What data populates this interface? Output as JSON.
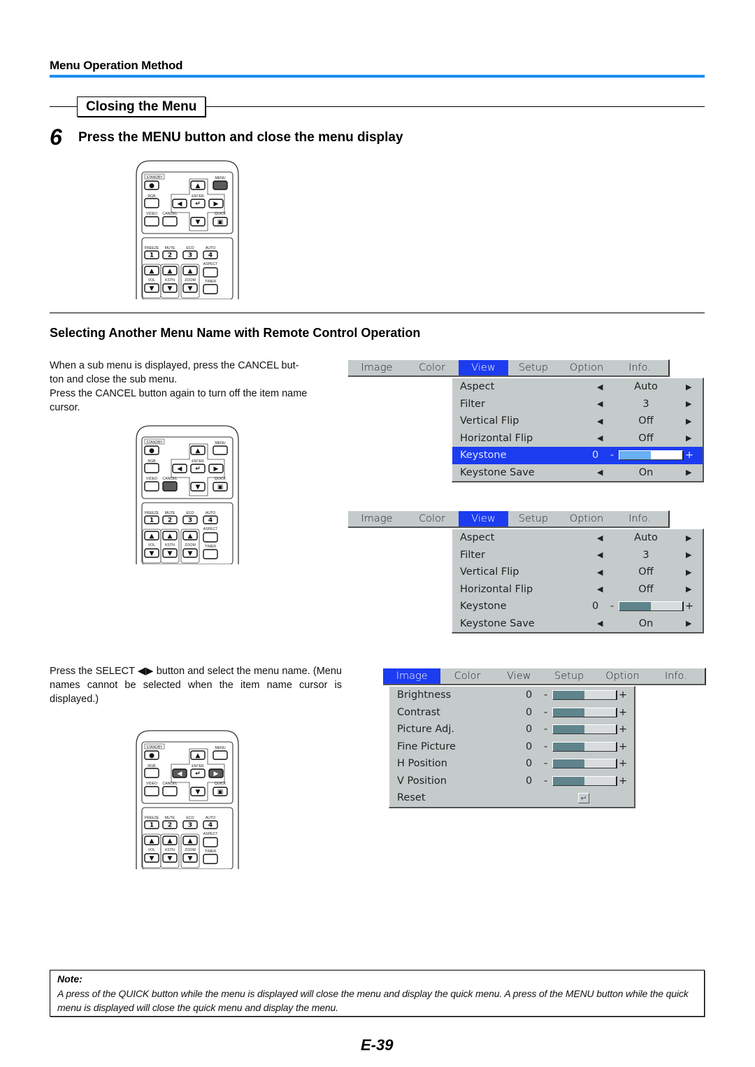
{
  "header": {
    "section_title": "Menu Operation Method",
    "subsection_title": "Closing the Menu",
    "step_number": "6",
    "step_title": "Press the MENU button and close the menu display"
  },
  "select_section": {
    "title": "Selecting Another Menu Name with Remote Control Operation",
    "para1_line1": "When a sub menu is displayed, press the CANCEL but-",
    "para1_line2": "ton and close the sub menu.",
    "para1_line3": "Press the CANCEL button again to turn off the item name",
    "para1_line4": "cursor.",
    "para2": "Press the SELECT ◀▶ button and select the menu name. (Menu names cannot be selected when the item name cursor is displayed.)"
  },
  "remote": {
    "labels": {
      "standby": "STANDBY",
      "menu": "MENU",
      "rgb": "RGB",
      "enter": "ENTER",
      "video": "VIDEO",
      "cancel": "CANCEL",
      "quick": "QUICK",
      "freeze": "FREEZE",
      "mute": "MUTE",
      "eco": "ECO",
      "auto": "AUTO",
      "aspect": "ASPECT",
      "vol": "VOL",
      "kstn": "KSTN",
      "zoom": "ZOOM",
      "timer": "TIMER",
      "n1": "1",
      "n2": "2",
      "n3": "3",
      "n4": "4"
    },
    "highlight_color": "#5a5a5a",
    "instances": [
      {
        "highlighted": [
          "menu"
        ]
      },
      {
        "highlighted": [
          "cancel"
        ]
      },
      {
        "highlighted": [
          "left",
          "right"
        ]
      }
    ]
  },
  "osd_view_highlighted": {
    "tabs": [
      "Image",
      "Color",
      "View",
      "Setup",
      "Option",
      "Info."
    ],
    "active_tab": "View",
    "rows": [
      {
        "label": "Aspect",
        "type": "select",
        "value": "Auto"
      },
      {
        "label": "Filter",
        "type": "select",
        "value": "3"
      },
      {
        "label": "Vertical Flip",
        "type": "select",
        "value": "Off"
      },
      {
        "label": "Horizontal Flip",
        "type": "select",
        "value": "Off"
      },
      {
        "label": "Keystone",
        "type": "slider",
        "value": "0",
        "fill": 0.5,
        "highlighted": true
      },
      {
        "label": "Keystone Save",
        "type": "select",
        "value": "On"
      }
    ]
  },
  "osd_view_plain": {
    "tabs": [
      "Image",
      "Color",
      "View",
      "Setup",
      "Option",
      "Info."
    ],
    "active_tab": "View",
    "rows": [
      {
        "label": "Aspect",
        "type": "select",
        "value": "Auto"
      },
      {
        "label": "Filter",
        "type": "select",
        "value": "3"
      },
      {
        "label": "Vertical Flip",
        "type": "select",
        "value": "Off"
      },
      {
        "label": "Horizontal Flip",
        "type": "select",
        "value": "Off"
      },
      {
        "label": "Keystone",
        "type": "slider",
        "value": "0",
        "fill": 0.5
      },
      {
        "label": "Keystone Save",
        "type": "select",
        "value": "On"
      }
    ]
  },
  "osd_image": {
    "tabs": [
      "Image",
      "Color",
      "View",
      "Setup",
      "Option",
      "Info."
    ],
    "active_tab": "Image",
    "rows": [
      {
        "label": "Brightness",
        "type": "slider",
        "value": "0",
        "fill": 0.5
      },
      {
        "label": "Contrast",
        "type": "slider",
        "value": "0",
        "fill": 0.5
      },
      {
        "label": "Picture Adj.",
        "type": "slider",
        "value": "0",
        "fill": 0.5
      },
      {
        "label": "Fine Picture",
        "type": "slider",
        "value": "0",
        "fill": 0.5
      },
      {
        "label": "H Position",
        "type": "slider",
        "value": "0",
        "fill": 0.5
      },
      {
        "label": "V Position",
        "type": "slider",
        "value": "0",
        "fill": 0.5
      },
      {
        "label": "Reset",
        "type": "enter"
      }
    ]
  },
  "osd_symbols": {
    "left_arrow": "◀",
    "right_arrow": "▶",
    "minus": "-",
    "plus": "+",
    "enter": "↵"
  },
  "note": {
    "title": "Note:",
    "body": "A press of the QUICK button while the menu is displayed will close the menu and display the quick menu. A press of the MENU button while the quick menu is displayed will close the quick menu and display the menu."
  },
  "footer": {
    "page_number": "E-39"
  }
}
